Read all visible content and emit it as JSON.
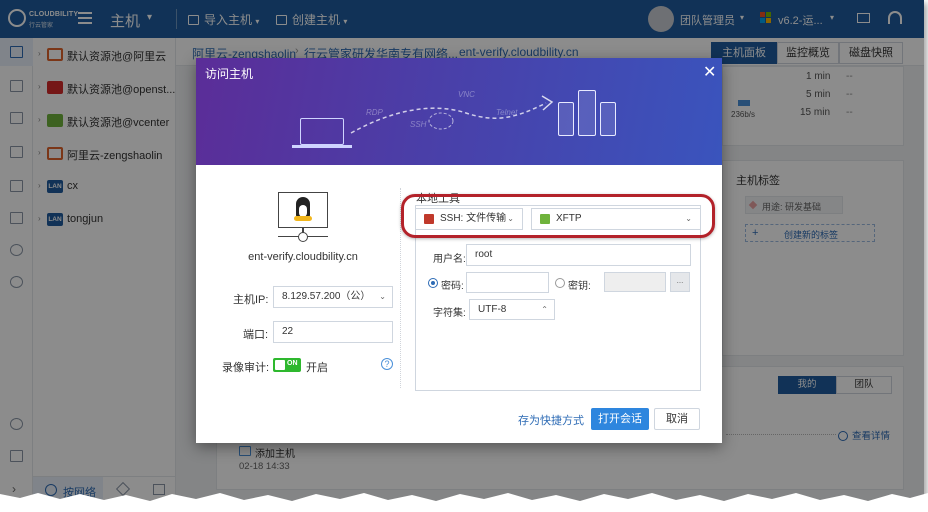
{
  "app": {
    "logo_text": "CLOUDBILITY",
    "logo_sub": "行云管家",
    "title": "主机",
    "import_label": "导入主机",
    "create_label": "创建主机",
    "user": "团队管理员",
    "version": "v6.2-运..."
  },
  "tree": {
    "items": [
      {
        "label": "默认资源池@阿里云",
        "icon": "aliyun-icon"
      },
      {
        "label": "默认资源池@openst...",
        "icon": "openstack-icon"
      },
      {
        "label": "默认资源池@vcenter",
        "icon": "vcenter-icon"
      },
      {
        "label": "阿里云-zengshaolin",
        "icon": "aliyun-icon"
      },
      {
        "label": "cx",
        "icon": "lan-icon",
        "badge": "LAN"
      },
      {
        "label": "tongjun",
        "icon": "lan-icon",
        "badge": "LAN"
      }
    ],
    "bottom_tab": "按网络"
  },
  "breadcrumb": [
    "阿里云-zengshaolin",
    "行云管家研发华南专有网络...",
    "ent-verify.cloudbility.cn"
  ],
  "main_tabs": [
    {
      "label": "主机面板",
      "active": true
    },
    {
      "label": "监控概览",
      "active": false
    },
    {
      "label": "磁盘快照",
      "active": false
    }
  ],
  "bandwidth": {
    "rows": [
      {
        "time": "1 min",
        "value": "--"
      },
      {
        "time": "5 min",
        "value": "--"
      },
      {
        "time": "15 min",
        "value": "--"
      }
    ],
    "bar_label": "236b/s"
  },
  "tags": {
    "title": "主机标签",
    "chip": "用途: 研发基础",
    "new_label": "创建新的标签"
  },
  "segment": [
    {
      "label": "我的",
      "active": true
    },
    {
      "label": "团队",
      "active": false
    }
  ],
  "activity": {
    "text": "添加主机",
    "time": "02-18 14:33",
    "detail_link": "查看详情"
  },
  "dialog": {
    "title": "访问主机",
    "header_protocols": [
      "RDP",
      "VNC",
      "SSH",
      "Telnet"
    ],
    "host_name": "ent-verify.cloudbility.cn",
    "ip_label": "主机IP:",
    "ip_value": "8.129.57.200（公）",
    "port_label": "端口:",
    "port_value": "22",
    "record_label": "录像审计:",
    "record_toggle": "ON",
    "record_state": "开启",
    "local_tool_title": "本地工具",
    "protocol_select": "SSH: 文件传输",
    "tool_select": "XFTP",
    "username_label": "用户名:",
    "username_value": "root",
    "password_label": "密码:",
    "key_label": "密钥:",
    "key_btn": "...",
    "charset_label": "字符集:",
    "charset_value": "UTF-8",
    "shortcut_link": "存为快捷方式",
    "open_button": "打开会话",
    "cancel_button": "取消"
  },
  "colors": {
    "topbar": "#1f5c9e",
    "accent": "#2e86de",
    "highlight": "#b3222a"
  }
}
